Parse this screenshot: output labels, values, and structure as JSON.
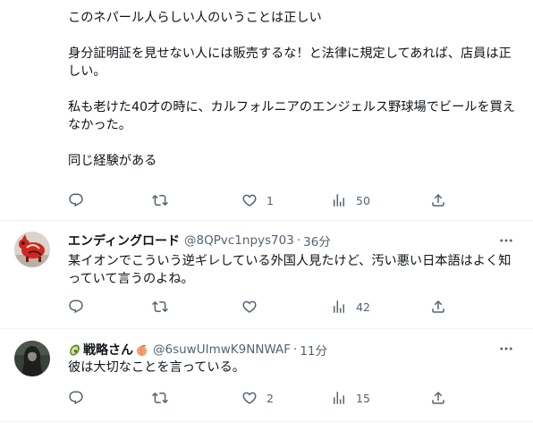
{
  "tweets": [
    {
      "text": "このネパール人らしい人のいうことは正しい\n\n身分証明証を見せない人には販売するな！と法律に規定してあれば、店員は正しい。\n\n私も老けた40才の時に、カルフォルニアのエンジェルス野球場でビールを買えなかった。\n\n同じ経験がある",
      "replies": "",
      "retweets": "",
      "likes": "1",
      "views": "50"
    },
    {
      "name": "エンディングロード",
      "handle": "@8QPvc1npys703",
      "dot": "·",
      "time": "36分",
      "text": "某イオンでこういう逆ギレしている外国人見たけど、汚い悪い日本語はよく知っていて言うのよね。",
      "replies": "",
      "retweets": "",
      "likes": "",
      "views": "42"
    },
    {
      "name": "戦略さん",
      "handle": "@6suwUImwK9NNWAF",
      "dot": "·",
      "time": "11分",
      "text": "彼は大切なことを言っている。",
      "replies": "",
      "retweets": "",
      "likes": "2",
      "views": "15"
    }
  ],
  "icons": {
    "reply": "reply-icon",
    "retweet": "retweet-icon",
    "like": "heart-icon",
    "views": "views-icon",
    "share": "share-icon",
    "more": "more-icon"
  },
  "colors": {
    "text": "#0f1419",
    "secondary": "#536471",
    "separator": "#eff3f4"
  }
}
